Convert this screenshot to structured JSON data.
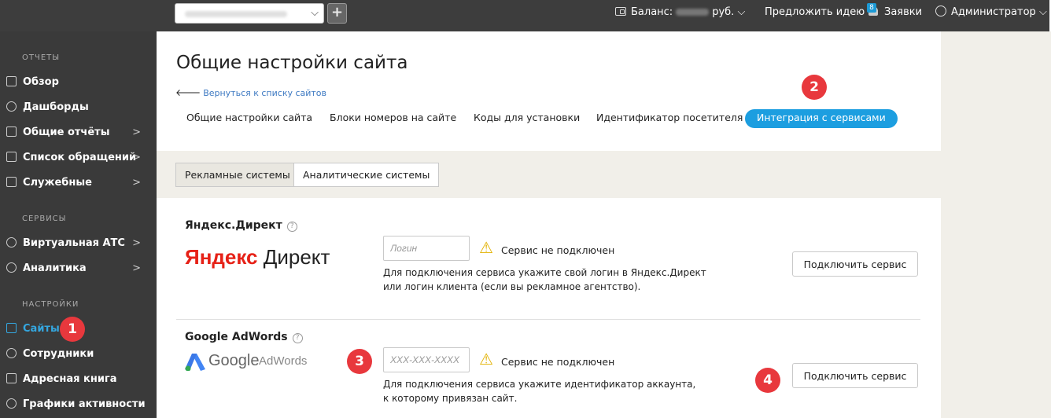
{
  "topbar": {
    "balance_label": "Баланс:",
    "balance_currency": "руб.",
    "suggest_idea": "Предложить идею",
    "requests_label": "Заявки",
    "requests_badge": "8",
    "admin_label": "Администратор"
  },
  "sidebar": {
    "sections": [
      "ОТЧЕТЫ",
      "СЕРВИСЫ",
      "НАСТРОЙКИ"
    ],
    "items": [
      {
        "label": "Обзор"
      },
      {
        "label": "Дашборды"
      },
      {
        "label": "Общие отчёты"
      },
      {
        "label": "Список обращений"
      },
      {
        "label": "Служебные"
      },
      {
        "label": "Виртуальная АТС"
      },
      {
        "label": "Аналитика"
      },
      {
        "label": "Сайты"
      },
      {
        "label": "Сотрудники"
      },
      {
        "label": "Адресная книга"
      },
      {
        "label": "Графики активности"
      }
    ],
    "arrow": ">"
  },
  "markers": [
    "1",
    "2",
    "3",
    "4"
  ],
  "main": {
    "title": "Общие настройки сайта",
    "back_link": "Вернуться к списку сайтов",
    "tabs": [
      {
        "label": "Общие настройки сайта"
      },
      {
        "label": "Блоки номеров на сайте"
      },
      {
        "label": "Коды для установки"
      },
      {
        "label": "Идентификатор посетителя"
      },
      {
        "label": "Интеграция с сервисами"
      }
    ],
    "subtabs": [
      {
        "label": "Рекламные системы"
      },
      {
        "label": "Аналитические системы"
      }
    ],
    "services": [
      {
        "name": "Яндекс.Директ",
        "logo_text_1": "Яндекс",
        "logo_text_2": "Директ",
        "placeholder": "Логин",
        "status": "Сервис не подключен",
        "desc_line1": "Для подключения сервиса укажите свой логин в Яндекс.Директ",
        "desc_line2": "или логин клиента (если вы рекламное агентство).",
        "button": "Подключить сервис"
      },
      {
        "name": "Google AdWords",
        "logo_text_1": "Google",
        "logo_text_2": "AdWords",
        "placeholder": "XXX-XXX-XXXX",
        "status": "Сервис не подключен",
        "desc_line1": "Для подключения сервиса укажите идентификатор аккаунта,",
        "desc_line2": "к которому привязан сайт.",
        "button": "Подключить сервис"
      }
    ]
  },
  "colors": {
    "accent": "#1c9ee0",
    "marker": "#e8383d",
    "sidebar_bg": "#3a3a3a",
    "topbar_bg": "#3d3d3d",
    "yandex_red": "#e62117"
  }
}
